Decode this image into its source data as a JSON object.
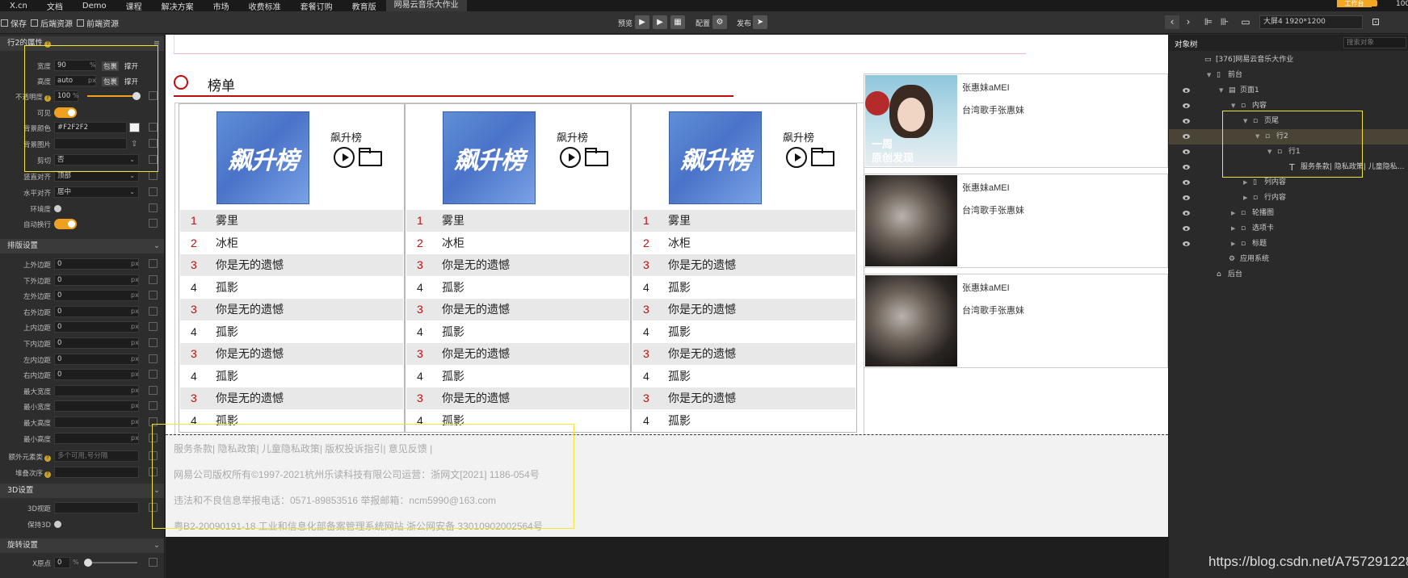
{
  "menu": {
    "logo": "X.cn",
    "items": [
      "文档",
      "Demo",
      "课程",
      "解决方案",
      "市场",
      "收费标准",
      "套餐订购",
      "教育版"
    ],
    "active_tab": "网易云音乐大作业",
    "upgrade_label": "工作台",
    "zoom": "100"
  },
  "toolbar": {
    "save": "保存",
    "backend": "后端资源",
    "frontend": "前端资源",
    "preview": "预览",
    "config": "配置",
    "publish": "发布",
    "device": "大屏4 1920*1200"
  },
  "left": {
    "section1_title": "行2的属性",
    "width_label": "宽度",
    "width_value": "90",
    "width_unit": "%",
    "wrap": "包裹",
    "expand": "撑开",
    "height_label": "高度",
    "height_value": "auto",
    "height_unit": "px",
    "opacity_label": "不透明度",
    "opacity_value": "100",
    "opacity_unit": "%",
    "visible_label": "可见",
    "bgcolor_label": "背景颜色",
    "bgcolor_value": "#F2F2F2",
    "bgimage_label": "背景图片",
    "clip_label": "剪切",
    "clip_value": "否",
    "valign_label": "竖直对齐",
    "valign_value": "顶部",
    "halign_label": "水平对齐",
    "halign_value": "居中",
    "wrapmode_label": "环境度",
    "autowrap_label": "自动换行",
    "section2_title": "排版设置",
    "layout_rows": [
      {
        "label": "上外边距",
        "value": "0"
      },
      {
        "label": "下外边距",
        "value": "0"
      },
      {
        "label": "左外边距",
        "value": "0"
      },
      {
        "label": "右外边距",
        "value": "0"
      },
      {
        "label": "上内边距",
        "value": "0"
      },
      {
        "label": "下内边距",
        "value": "0"
      },
      {
        "label": "左内边距",
        "value": "0"
      },
      {
        "label": "右内边距",
        "value": "0"
      },
      {
        "label": "最大宽度",
        "value": ""
      },
      {
        "label": "最小宽度",
        "value": ""
      },
      {
        "label": "最大高度",
        "value": ""
      },
      {
        "label": "最小高度",
        "value": ""
      }
    ],
    "px": "px",
    "extra_class_label": "额外元素类",
    "extra_class_placeholder": "多个可用,号分隔",
    "zindex_label": "堆叠次序",
    "section3_title": "3D设置",
    "view3d_label": "3D视距",
    "keep3d_label": "保持3D",
    "section4_title": "旋转设置",
    "xorigin_label": "X原点",
    "xorigin_value": "0",
    "xorigin_unit": "%"
  },
  "canvas": {
    "heading": "榜单",
    "columns": [
      {
        "cover_text": "飙升榜",
        "label": "飙升榜"
      },
      {
        "cover_text": "飙升榜",
        "label": "飙升榜"
      },
      {
        "cover_text": "飙升榜",
        "label": "飙升榜"
      }
    ],
    "songs": [
      {
        "idx": "1",
        "name": "雾里",
        "red": true
      },
      {
        "idx": "2",
        "name": "冰柜",
        "red": true
      },
      {
        "idx": "3",
        "name": "你是无的遗憾",
        "red": true
      },
      {
        "idx": "4",
        "name": "孤影",
        "red": false
      },
      {
        "idx": "3",
        "name": "你是无的遗憾",
        "red": true
      },
      {
        "idx": "4",
        "name": "孤影",
        "red": false
      },
      {
        "idx": "3",
        "name": "你是无的遗憾",
        "red": true
      },
      {
        "idx": "4",
        "name": "孤影",
        "red": false
      },
      {
        "idx": "3",
        "name": "你是无的遗憾",
        "red": true
      },
      {
        "idx": "4",
        "name": "孤影",
        "red": false
      }
    ],
    "artists": [
      {
        "name": "张惠妹aMEI",
        "desc": "台湾歌手张惠妹",
        "cover_line1": "一周",
        "cover_line2": "原创发现"
      },
      {
        "name": "张惠妹aMEI",
        "desc": "台湾歌手张惠妹"
      },
      {
        "name": "张惠妹aMEI",
        "desc": "台湾歌手张惠妹"
      }
    ],
    "footer": [
      "服务条款| 隐私政策| 儿童隐私政策| 版权投诉指引| 意见反馈 |",
      "网易公司版权所有©1997-2021杭州乐读科技有限公司运营：浙网文[2021] 1186-054号",
      "违法和不良信息举报电话：0571-89853516 举报邮箱：ncm5990@163.com",
      "粤B2-20090191-18  工业和信息化部备案管理系统网站  浙公网安备 33010902002564号"
    ]
  },
  "right": {
    "tab": "对象树",
    "search_placeholder": "搜索对象",
    "tree": [
      {
        "label": "[376]网易云音乐大作业",
        "indent": 0,
        "eye": false,
        "arrow": "",
        "icon": "monitor-icon"
      },
      {
        "label": "前台",
        "indent": 1,
        "eye": false,
        "arrow": "▼",
        "icon": "phone-icon"
      },
      {
        "label": "页面1",
        "indent": 2,
        "eye": true,
        "arrow": "▼",
        "icon": "page-icon"
      },
      {
        "label": "内容",
        "indent": 3,
        "eye": true,
        "arrow": "▼",
        "icon": "div-icon"
      },
      {
        "label": "页尾",
        "indent": 4,
        "eye": true,
        "arrow": "▼",
        "icon": "div-icon"
      },
      {
        "label": "行2",
        "indent": 5,
        "eye": true,
        "arrow": "▼",
        "icon": "div-icon",
        "selected": true
      },
      {
        "label": "行1",
        "indent": 6,
        "eye": true,
        "arrow": "▼",
        "icon": "div-icon"
      },
      {
        "label": "服务条款| 隐私政策| 儿童隐私...",
        "indent": 7,
        "eye": true,
        "arrow": "",
        "icon": "text-icon"
      },
      {
        "label": "列内容",
        "indent": 4,
        "eye": true,
        "arrow": "▶",
        "icon": "col-icon"
      },
      {
        "label": "行内容",
        "indent": 4,
        "eye": true,
        "arrow": "▶",
        "icon": "div-icon"
      },
      {
        "label": "轮播图",
        "indent": 3,
        "eye": true,
        "arrow": "▶",
        "icon": "div-icon"
      },
      {
        "label": "选项卡",
        "indent": 3,
        "eye": true,
        "arrow": "▶",
        "icon": "div-icon"
      },
      {
        "label": "标题",
        "indent": 3,
        "eye": true,
        "arrow": "▶",
        "icon": "div-icon"
      },
      {
        "label": "应用系统",
        "indent": 2,
        "eye": false,
        "arrow": "",
        "icon": "gear-icon"
      },
      {
        "label": "后台",
        "indent": 1,
        "eye": false,
        "arrow": "",
        "icon": "home-icon"
      }
    ]
  },
  "watermark": "https://blog.csdn.net/A757291228"
}
